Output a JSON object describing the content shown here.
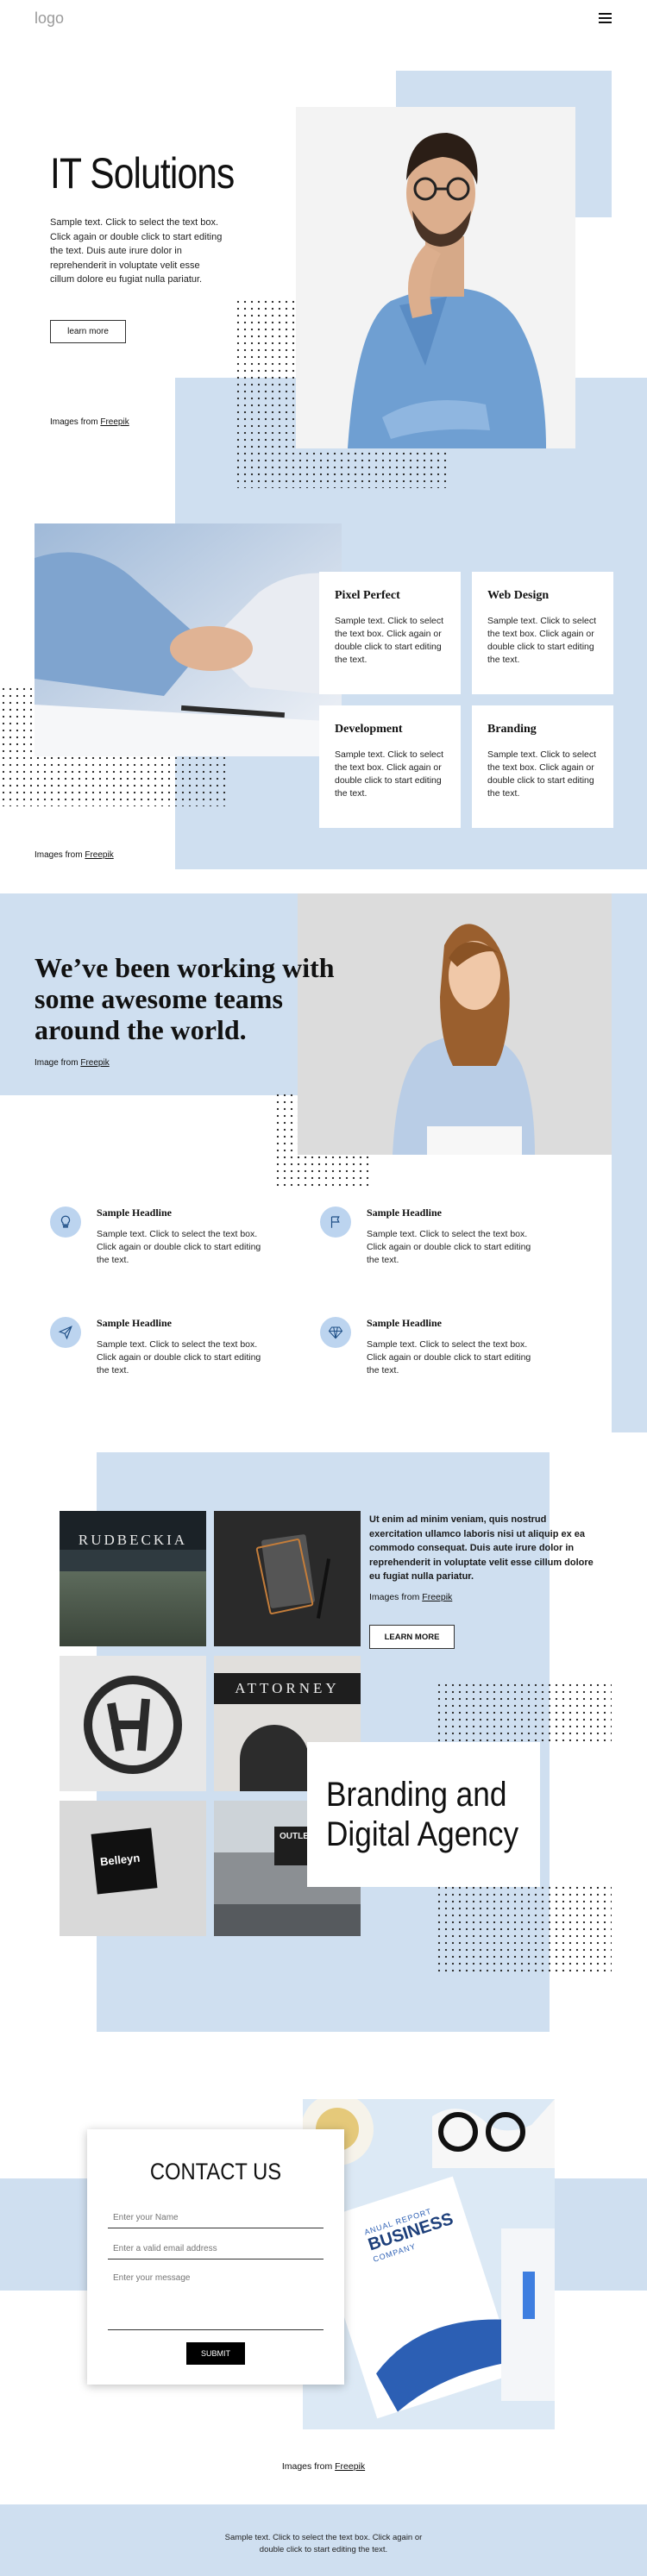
{
  "header": {
    "logo": "logo"
  },
  "hero": {
    "title": "IT Solutions",
    "text": "Sample text. Click to select the text box. Click again or double click to start editing the text. Duis aute irure dolor in reprehenderit in voluptate velit esse cillum dolore eu fugiat nulla pariatur.",
    "button": "learn more",
    "credit_prefix": "Images from ",
    "credit_link": "Freepik"
  },
  "services": {
    "cards": [
      {
        "title": "Pixel Perfect",
        "text": "Sample text. Click to select the text box. Click again or double click to start editing the text."
      },
      {
        "title": "Web Design",
        "text": "Sample text. Click to select the text box. Click again or double click to start editing the text."
      },
      {
        "title": "Development",
        "text": "Sample text. Click to select the text box. Click again or double click to start editing the text."
      },
      {
        "title": "Branding",
        "text": "Sample text. Click to select the text box. Click again or double click to start editing the text."
      }
    ],
    "credit_prefix": "Images from ",
    "credit_link": "Freepik"
  },
  "teams": {
    "headline": "We’ve been working with some awesome teams around the world.",
    "credit_prefix": "Image from ",
    "credit_link": "Freepik",
    "features": [
      {
        "icon": "lightbulb-icon",
        "title": "Sample Headline",
        "text": "Sample text. Click to select the text box. Click again or double click to start editing the text."
      },
      {
        "icon": "flag-icon",
        "title": "Sample Headline",
        "text": "Sample text. Click to select the text box. Click again or double click to start editing the text."
      },
      {
        "icon": "paper-plane-icon",
        "title": "Sample Headline",
        "text": "Sample text. Click to select the text box. Click again or double click to start editing the text."
      },
      {
        "icon": "diamond-icon",
        "title": "Sample Headline",
        "text": "Sample text. Click to select the text box. Click again or double click to start editing the text."
      }
    ]
  },
  "agency": {
    "text": "Ut enim ad minim veniam, quis nostrud exercitation ullamco laboris nisi ut aliquip ex ea commodo consequat. Duis aute irure dolor in reprehenderit in voluptate velit esse cillum dolore eu fugiat nulla pariatur.",
    "credit_prefix": "Images from ",
    "credit_link": "Freepik",
    "button": "LEARN MORE",
    "title_line1": "Branding and",
    "title_line2": "Digital Agency",
    "tiles": {
      "rudbeckia": "RUDBECKIA",
      "attorney": "ATTORNEY",
      "belleyn": "Belleyn",
      "outlet": "OUTLET STOCK"
    }
  },
  "contact": {
    "title": "CONTACT US",
    "name_placeholder": "Enter your Name",
    "email_placeholder": "Enter a valid email address",
    "message_placeholder": "Enter your message",
    "submit": "SUBMIT",
    "report": {
      "line1": "ANUAL REPORT",
      "line2": "BUSINESS",
      "line3": "COMPANY"
    },
    "credit_prefix": "Images from ",
    "credit_link": "Freepik"
  },
  "footer": {
    "text": "Sample text. Click to select the text box. Click again or double click to start editing the text."
  },
  "colors": {
    "accent_blue": "#cfdff0",
    "icon_blue": "#bcd4ef",
    "dark": "#111111"
  }
}
